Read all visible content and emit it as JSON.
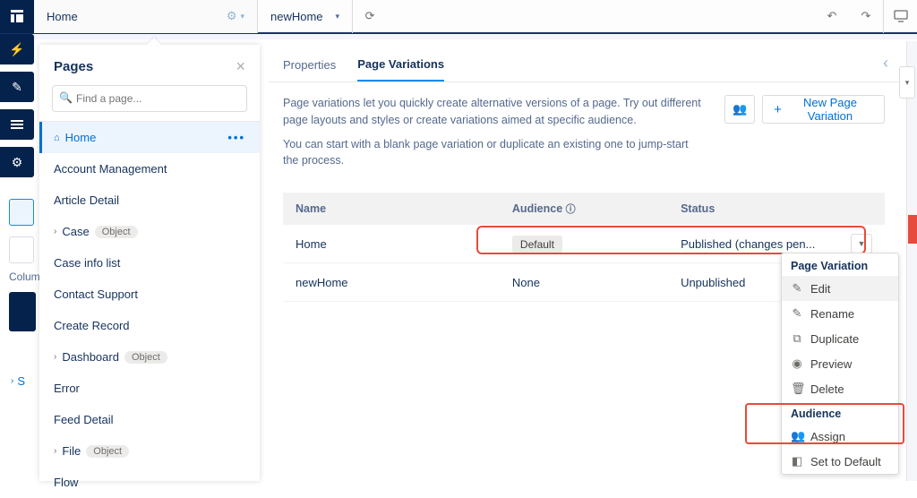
{
  "topbar": {
    "tab_home": "Home",
    "variation_name": "newHome"
  },
  "sidebar_bg": {
    "columns_label": "Colum",
    "settings_link_prefix": "S"
  },
  "pages_panel": {
    "title": "Pages",
    "search_placeholder": "Find a page...",
    "items": [
      {
        "label": "Home",
        "active": true,
        "icon": "home"
      },
      {
        "label": "Account Management"
      },
      {
        "label": "Article Detail"
      },
      {
        "label": "Case",
        "chevron": true,
        "pill": "Object"
      },
      {
        "label": "Case info list"
      },
      {
        "label": "Contact Support"
      },
      {
        "label": "Create Record"
      },
      {
        "label": "Dashboard",
        "chevron": true,
        "pill": "Object"
      },
      {
        "label": "Error"
      },
      {
        "label": "Feed Detail"
      },
      {
        "label": "File",
        "chevron": true,
        "pill": "Object"
      },
      {
        "label": "Flow"
      }
    ]
  },
  "main": {
    "tabs": {
      "properties": "Properties",
      "variations": "Page Variations"
    },
    "desc1": "Page variations let you quickly create alternative versions of a page. Try out different page layouts and styles or create variations aimed at specific audience.",
    "desc2": "You can start with a blank page variation or duplicate an existing one to jump-start the process.",
    "new_btn": "New Page Variation",
    "table": {
      "headers": {
        "name": "Name",
        "audience": "Audience",
        "status": "Status"
      },
      "rows": [
        {
          "name": "Home",
          "audience_badge": "Default",
          "status": "Published (changes pen..."
        },
        {
          "name": "newHome",
          "audience": "None",
          "status": "Unpublished"
        }
      ]
    }
  },
  "dropdown": {
    "section1": "Page Variation",
    "items1": [
      {
        "icon": "✎",
        "label": "Edit"
      },
      {
        "icon": "✎",
        "label": "Rename"
      },
      {
        "icon": "⧉",
        "label": "Duplicate"
      },
      {
        "icon": "◉",
        "label": "Preview"
      },
      {
        "icon": "🗑",
        "label": "Delete"
      }
    ],
    "section2": "Audience",
    "items2": [
      {
        "icon": "👥",
        "label": "Assign"
      },
      {
        "icon": "◧",
        "label": "Set to Default"
      }
    ]
  }
}
